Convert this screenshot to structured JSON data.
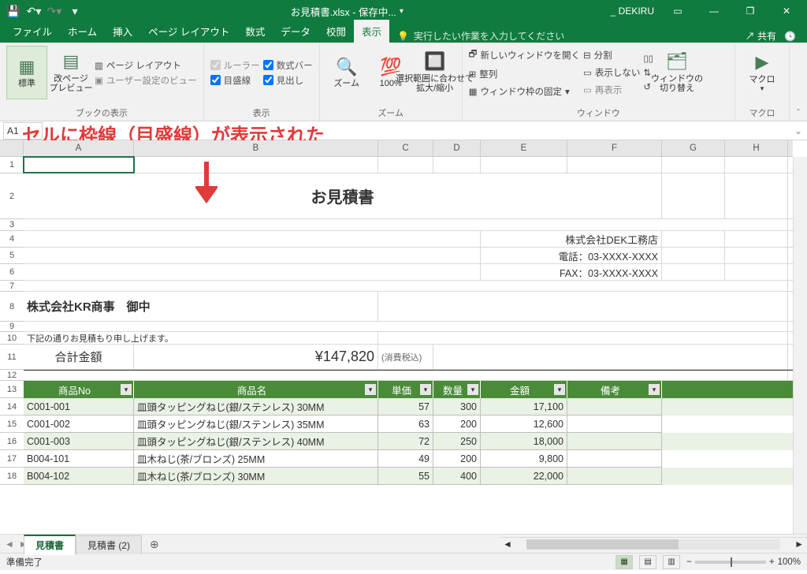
{
  "titlebar": {
    "filename": "お見積書.xlsx - 保存中...",
    "user": "_ DEKIRU"
  },
  "tabs": {
    "file": "ファイル",
    "home": "ホーム",
    "insert": "挿入",
    "layout": "ページ レイアウト",
    "formula": "数式",
    "data": "データ",
    "review": "校閲",
    "view": "表示",
    "tellme": "実行したい作業を入力してください",
    "share": "共有"
  },
  "ribbon": {
    "view_group": "ブックの表示",
    "std": "標準",
    "pbreak": "改ページ\nプレビュー",
    "page_layout": "ページ レイアウト",
    "custom": "ユーザー設定のビュー",
    "show_group": "表示",
    "ruler": "ルーラー",
    "formula_bar": "数式バー",
    "grid": "目盛線",
    "heading": "見出し",
    "zoom_group": "ズーム",
    "zoom": "ズーム",
    "z100": "100%",
    "zsel": "選択範囲に合わせて\n拡大/縮小",
    "window_group": "ウィンドウ",
    "neww": "新しいウィンドウを開く",
    "arrange": "整列",
    "freeze": "ウィンドウ枠の固定",
    "split": "分割",
    "hide": "表示しない",
    "unhide": "再表示",
    "switch": "ウィンドウの\n切り替え",
    "macro_group": "マクロ",
    "macro": "マクロ"
  },
  "namebox": "A1",
  "callout": "セルに枠線（目盛線）が表示された",
  "columns": [
    "A",
    "B",
    "C",
    "D",
    "E",
    "F",
    "G",
    "H"
  ],
  "rows": [
    "1",
    "2",
    "3",
    "4",
    "5",
    "6",
    "7",
    "8",
    "9",
    "10",
    "11",
    "12",
    "13",
    "14",
    "15",
    "16",
    "17",
    "18"
  ],
  "doc": {
    "title": "お見積書",
    "company_to": "株式会社KR商事　御中",
    "company_from": "株式会社DEK工務店",
    "phone": "電話：03-XXXX-XXXX",
    "fax": "FAX：03-XXXX-XXXX",
    "note": "下記の通りお見積もり申し上げます。",
    "total_label": "合計金額",
    "total_value": "¥147,820",
    "tax_note": "(消費税込)"
  },
  "table": {
    "headers": [
      "商品No",
      "商品名",
      "単価",
      "数量",
      "金額",
      "備考"
    ],
    "rows": [
      {
        "no": "C001-001",
        "name": "皿頭タッピングねじ(銀/ステンレス) 30MM",
        "price": "57",
        "qty": "300",
        "amt": "17,100",
        "note": ""
      },
      {
        "no": "C001-002",
        "name": "皿頭タッピングねじ(銀/ステンレス) 35MM",
        "price": "63",
        "qty": "200",
        "amt": "12,600",
        "note": ""
      },
      {
        "no": "C001-003",
        "name": "皿頭タッピングねじ(銀/ステンレス) 40MM",
        "price": "72",
        "qty": "250",
        "amt": "18,000",
        "note": ""
      },
      {
        "no": "B004-101",
        "name": "皿木ねじ(茶/ブロンズ) 25MM",
        "price": "49",
        "qty": "200",
        "amt": "9,800",
        "note": ""
      },
      {
        "no": "B004-102",
        "name": "皿木ねじ(茶/ブロンズ) 30MM",
        "price": "55",
        "qty": "400",
        "amt": "22,000",
        "note": ""
      }
    ]
  },
  "sheets": {
    "s1": "見積書",
    "s2": "見積書 (2)"
  },
  "status": {
    "ready": "準備完了",
    "zoom": "100%"
  },
  "colwidths": {
    "A": 140,
    "B": 310,
    "C": 70,
    "D": 60,
    "E": 110,
    "F": 120,
    "G": 80,
    "H": 80
  },
  "rowheights": {
    "r1": 21,
    "r2": 58,
    "r3": 15,
    "r4": 21,
    "r5": 21,
    "r6": 21,
    "r7": 14,
    "r8": 38,
    "r9": 13,
    "r10": 16,
    "r11": 32,
    "r12": 14
  }
}
